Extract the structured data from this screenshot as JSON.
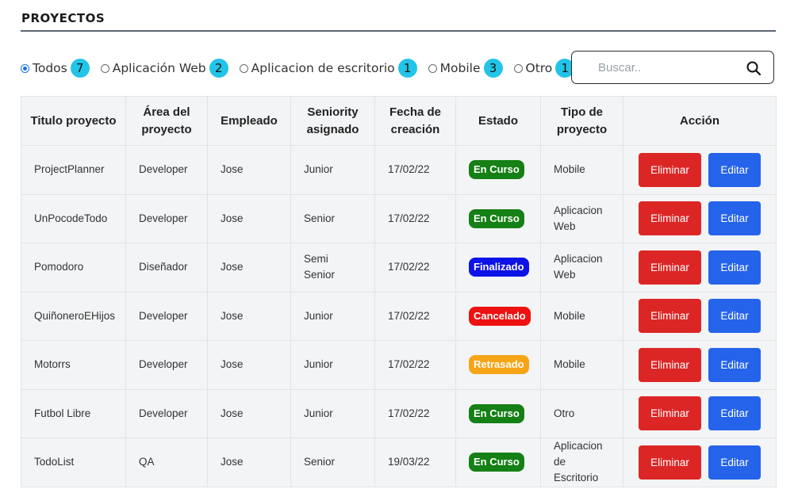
{
  "page": {
    "title": "PROYECTOS"
  },
  "filters": [
    {
      "label": "Todos",
      "count": "7",
      "checked": true
    },
    {
      "label": "Aplicación Web",
      "count": "2",
      "checked": false
    },
    {
      "label": "Aplicacion de escritorio",
      "count": "1",
      "checked": false
    },
    {
      "label": "Mobile",
      "count": "3",
      "checked": false
    },
    {
      "label": "Otro",
      "count": "1",
      "checked": false
    }
  ],
  "search": {
    "placeholder": "Buscar..",
    "value": "",
    "icon": "search-icon"
  },
  "table": {
    "headers": [
      "Titulo proyecto",
      "Área del proyecto",
      "Empleado",
      "Seniority asignado",
      "Fecha de creación",
      "Estado",
      "Tipo de proyecto",
      "Acción"
    ],
    "status_colors": {
      "En Curso": "#158015",
      "Finalizado": "#0d12e8",
      "Cancelado": "#ee1111",
      "Retrasado": "#f5a516"
    },
    "rows": [
      {
        "titulo": "ProjectPlanner",
        "area": "Developer",
        "empleado": "Jose",
        "seniority": "Junior",
        "fecha": "17/02/22",
        "estado": "En Curso",
        "tipo": "Mobile"
      },
      {
        "titulo": "UnPocodeTodo",
        "area": "Developer",
        "empleado": "Jose",
        "seniority": "Senior",
        "fecha": "17/02/22",
        "estado": "En Curso",
        "tipo": "Aplicacion Web"
      },
      {
        "titulo": "Pomodoro",
        "area": "Diseñador",
        "empleado": "Jose",
        "seniority": "Semi Senior",
        "fecha": "17/02/22",
        "estado": "Finalizado",
        "tipo": "Aplicacion Web"
      },
      {
        "titulo": "QuiñoneroEHijos",
        "area": "Developer",
        "empleado": "Jose",
        "seniority": "Junior",
        "fecha": "17/02/22",
        "estado": "Cancelado",
        "tipo": "Mobile"
      },
      {
        "titulo": "Motorrs",
        "area": "Developer",
        "empleado": "Jose",
        "seniority": "Junior",
        "fecha": "17/02/22",
        "estado": "Retrasado",
        "tipo": "Mobile"
      },
      {
        "titulo": "Futbol Libre",
        "area": "Developer",
        "empleado": "Jose",
        "seniority": "Junior",
        "fecha": "17/02/22",
        "estado": "En Curso",
        "tipo": "Otro"
      },
      {
        "titulo": "TodoList",
        "area": "QA",
        "empleado": "Jose",
        "seniority": "Senior",
        "fecha": "19/03/22",
        "estado": "En Curso",
        "tipo": "Aplicacion de Escritorio"
      }
    ],
    "actions": {
      "delete_label": "Eliminar",
      "edit_label": "Editar"
    }
  }
}
